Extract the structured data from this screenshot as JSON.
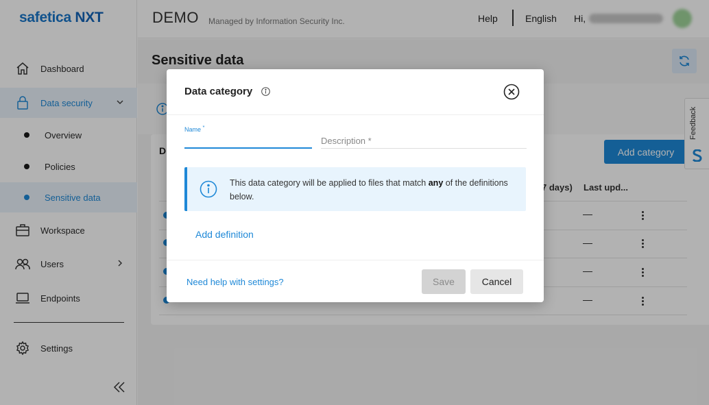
{
  "brand": {
    "name": "safetica",
    "suffix": "NXT"
  },
  "sidebar": {
    "items": [
      {
        "label": "Dashboard",
        "icon": "home-icon"
      },
      {
        "label": "Data security",
        "icon": "lock-icon",
        "expanded": true,
        "active": true
      },
      {
        "label": "Workspace",
        "icon": "briefcase-icon"
      },
      {
        "label": "Users",
        "icon": "users-icon"
      },
      {
        "label": "Endpoints",
        "icon": "laptop-icon"
      },
      {
        "label": "Settings",
        "icon": "gear-icon"
      }
    ],
    "sub_items": [
      {
        "label": "Overview"
      },
      {
        "label": "Policies"
      },
      {
        "label": "Sensitive data",
        "active": true
      }
    ]
  },
  "header": {
    "title": "DEMO",
    "subtitle": "Managed by Information Security Inc.",
    "help": "Help",
    "language": "English",
    "greeting": "Hi,"
  },
  "page": {
    "title": "Sensitive data",
    "card_heading_fragment": "D",
    "add_category": "Add category",
    "columns": {
      "days_fragment": "7 days)",
      "last_updated": "Last upd..."
    },
    "rows": [
      {
        "last_updated": "—"
      },
      {
        "last_updated": "—"
      },
      {
        "last_updated": "—"
      },
      {
        "last_updated": "—"
      }
    ]
  },
  "feedback": {
    "label": "Feedback"
  },
  "modal": {
    "title": "Data category",
    "name_label": "Name",
    "name_required": "*",
    "name_value": "",
    "description_placeholder": "Description *",
    "notice_pre": "This data category will be applied to files that match ",
    "notice_bold": "any",
    "notice_post": " of the definitions below.",
    "add_definition": "Add definition",
    "help_link": "Need help with settings?",
    "save": "Save",
    "cancel": "Cancel"
  },
  "colors": {
    "accent": "#1e88d7",
    "notice_bg": "#e8f4fd",
    "overlay": "rgba(0,0,0,0.30)"
  }
}
